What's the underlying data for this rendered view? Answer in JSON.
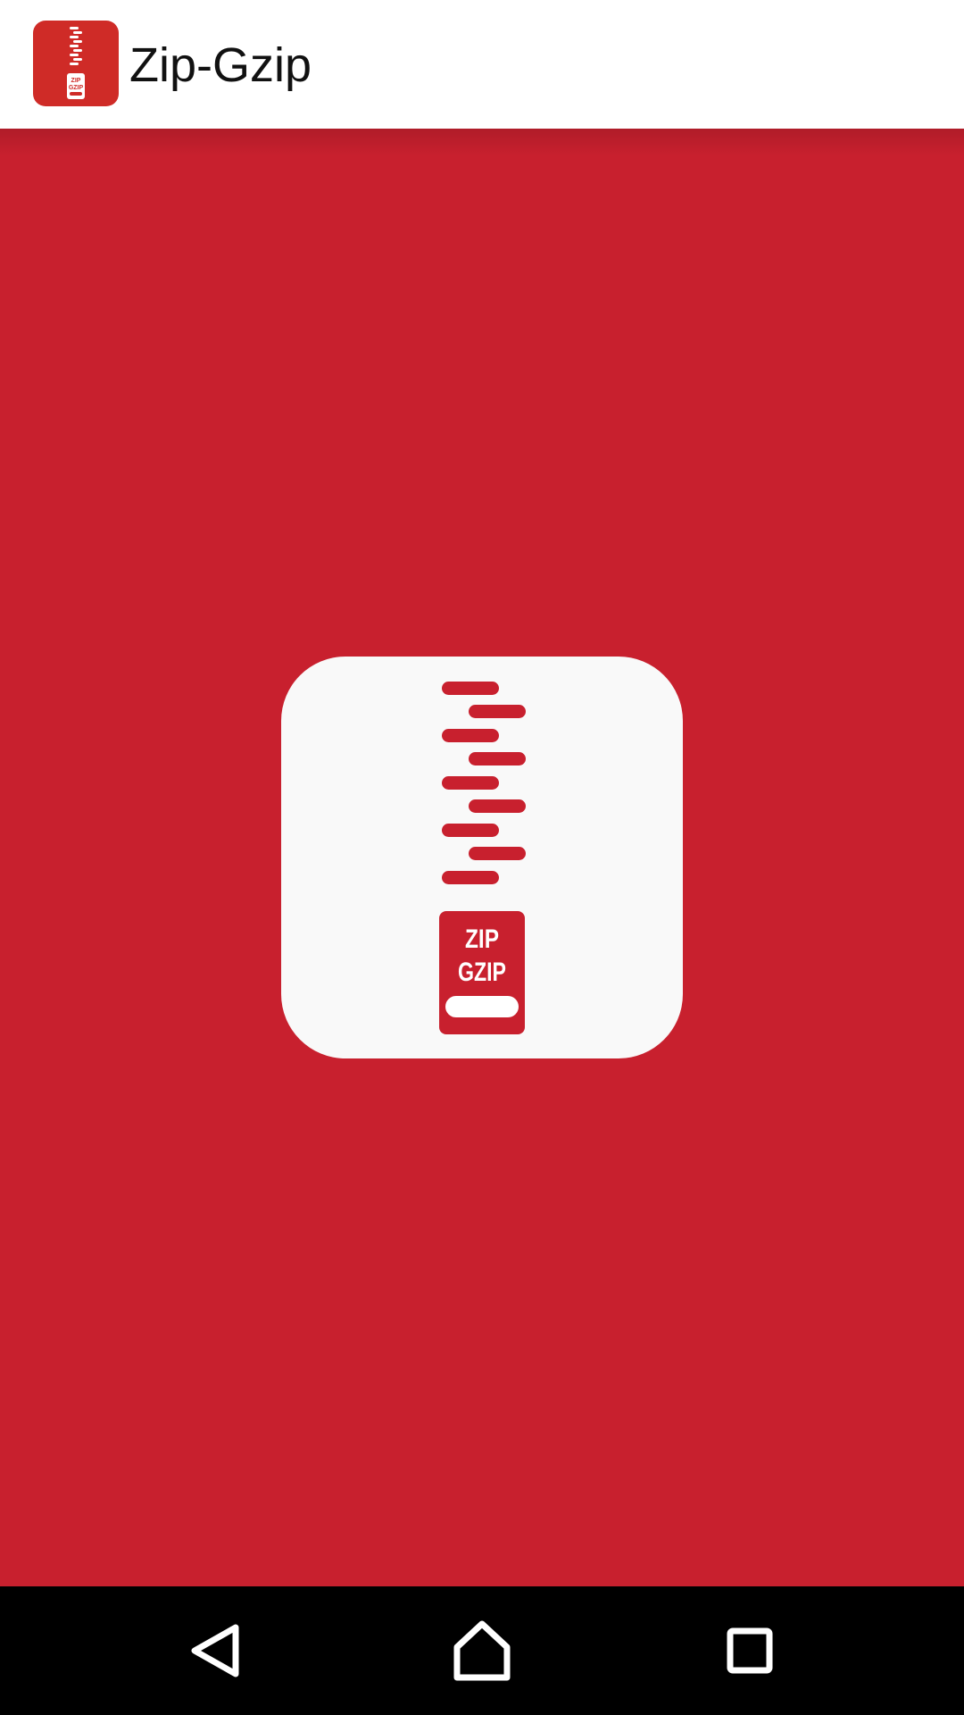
{
  "app_bar": {
    "title": "Zip-Gzip",
    "icon_name": "zip-gzip-app-icon"
  },
  "splash": {
    "background_color": "#c8202e",
    "logo_icon_name": "zip-gzip-logo-icon",
    "logo_text_line1": "ZIP",
    "logo_text_line2": "GZIP"
  },
  "nav_bar": {
    "back_icon": "back-icon",
    "home_icon": "home-icon",
    "recents_icon": "recents-icon"
  },
  "colors": {
    "brand_red": "#c8202e",
    "icon_red": "#cf2b27",
    "card": "#f9f9f9",
    "app_bar": "#ffffff",
    "nav_bar": "#000000"
  }
}
